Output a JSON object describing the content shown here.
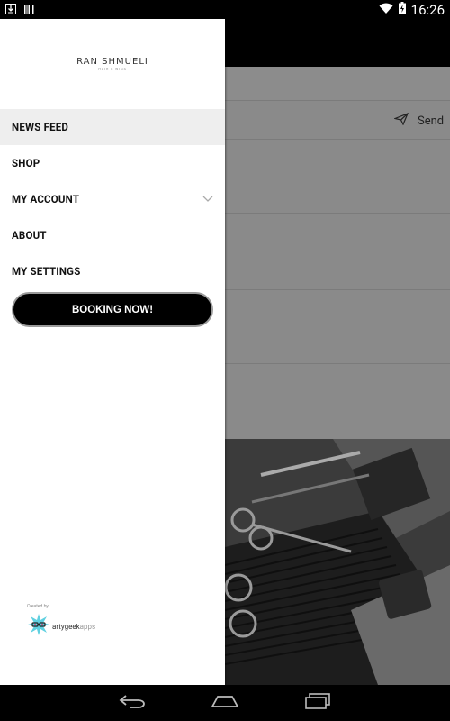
{
  "status_bar": {
    "time": "16:26",
    "icons": [
      "download-icon",
      "barcode-icon",
      "wifi-icon",
      "battery-charging-icon"
    ]
  },
  "drawer": {
    "logo": {
      "main": "RAN SHMUELI",
      "sub": "HAIR & WIGS"
    },
    "menu": [
      {
        "label": "NEWS FEED",
        "active": true
      },
      {
        "label": "SHOP",
        "active": false
      },
      {
        "label": "MY ACCOUNT",
        "active": false,
        "expandable": true
      },
      {
        "label": "ABOUT",
        "active": false
      },
      {
        "label": "MY SETTINGS",
        "active": false
      }
    ],
    "booking_button": "BOOKING NOW!",
    "created_by_label": "Created by:",
    "brand": {
      "part1": "artygeek",
      "part2": "apps"
    }
  },
  "background": {
    "send_label": "Send"
  },
  "nav_bar": {
    "icons": [
      "back-icon",
      "home-icon",
      "recent-apps-icon"
    ]
  }
}
